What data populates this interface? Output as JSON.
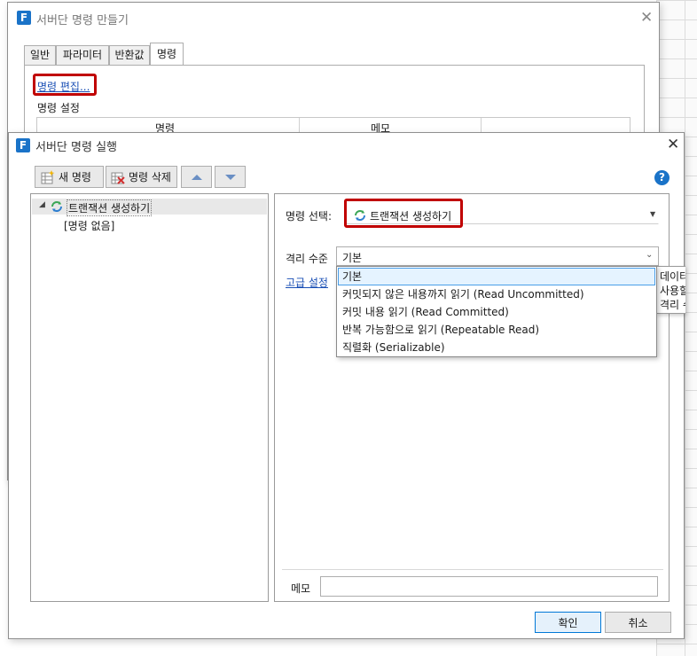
{
  "back_dialog": {
    "title": "서버단 명령 만들기",
    "tabs": [
      {
        "label": "일반",
        "active": false
      },
      {
        "label": "파라미터",
        "active": false
      },
      {
        "label": "반환값",
        "active": false
      },
      {
        "label": "명령",
        "active": true
      }
    ],
    "edit_link": "명령 편집...",
    "settings_label": "명령 설정",
    "table_headers": [
      "명령",
      "메모"
    ]
  },
  "front_dialog": {
    "title": "서버단 명령 실행",
    "toolbar": {
      "new_label": "새 명령",
      "delete_label": "명령 삭제"
    },
    "tree": {
      "root_label": "트랜잭션 생성하기",
      "child_label": "[명령 없음]"
    },
    "command_select_label": "명령 선택:",
    "command_select_value": "트랜잭션 생성하기",
    "isolation_label": "격리 수준",
    "isolation_value": "기본",
    "isolation_options": [
      "기본",
      "커밋되지 않은 내용까지 읽기 (Read Uncommitted)",
      "커밋 내용 읽기 (Read Committed)",
      "반복 가능함으로 읽기 (Repeatable Read)",
      "직렬화 (Serializable)"
    ],
    "advanced_link": "고급 설정",
    "tooltip_lines": [
      "데이터",
      "사용할",
      "격리 수"
    ],
    "memo_label": "메모",
    "memo_value": "",
    "ok_label": "확인",
    "cancel_label": "취소"
  },
  "colors": {
    "accent": "#1a73c8",
    "highlight_border": "#c00000",
    "link": "#1a4fb5",
    "icon_green": "#3aa655",
    "icon_blue": "#2f7fd0"
  }
}
